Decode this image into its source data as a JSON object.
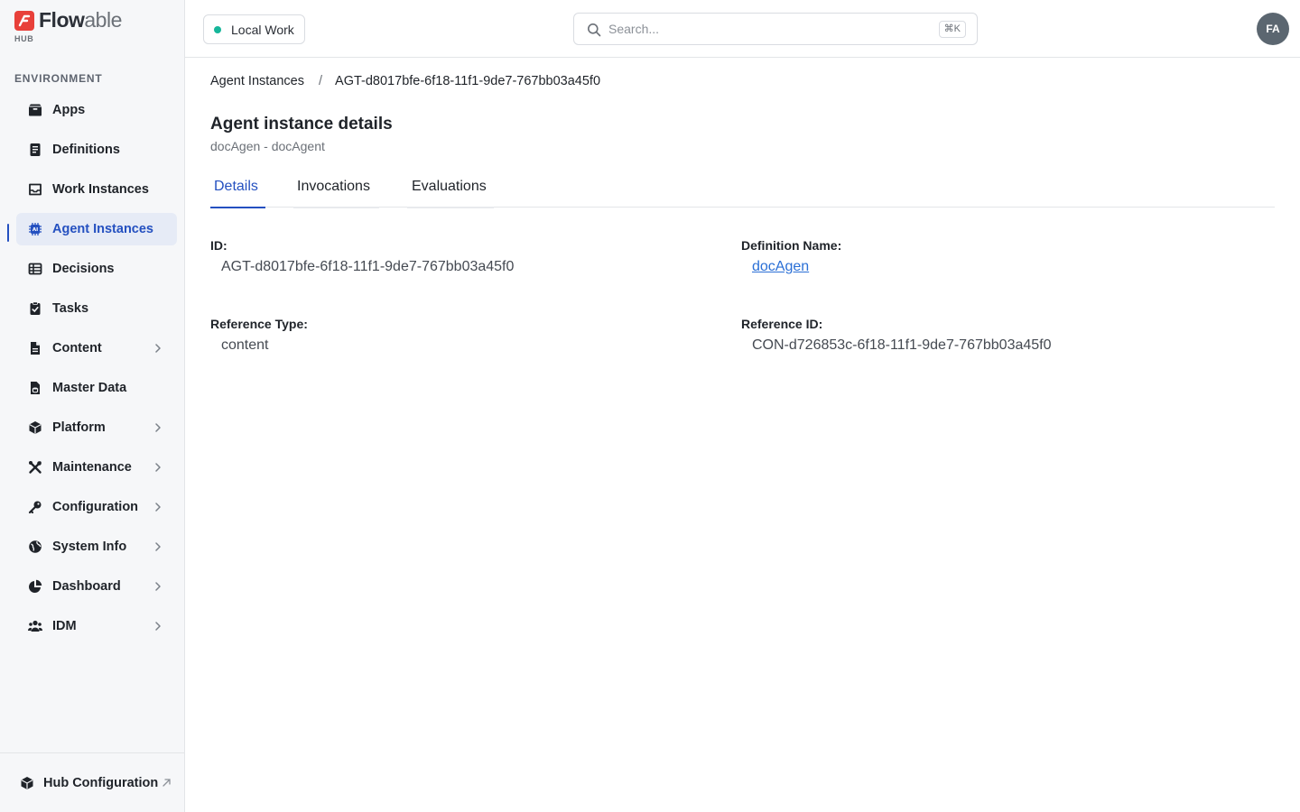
{
  "brand": {
    "name_bold": "Flow",
    "name_light": "able",
    "sub": "HUB"
  },
  "sidebar": {
    "section_label": "ENVIRONMENT",
    "items": [
      {
        "label": "Apps",
        "icon": "box-icon"
      },
      {
        "label": "Definitions",
        "icon": "document-list-icon"
      },
      {
        "label": "Work Instances",
        "icon": "inbox-icon"
      },
      {
        "label": "Agent Instances",
        "icon": "ai-chip-icon",
        "active": true
      },
      {
        "label": "Decisions",
        "icon": "table-icon"
      },
      {
        "label": "Tasks",
        "icon": "clipboard-check-icon"
      },
      {
        "label": "Content",
        "icon": "file-icon",
        "expandable": true
      },
      {
        "label": "Master Data",
        "icon": "file-database-icon"
      },
      {
        "label": "Platform",
        "icon": "cube-icon",
        "expandable": true
      },
      {
        "label": "Maintenance",
        "icon": "tools-icon",
        "expandable": true
      },
      {
        "label": "Configuration",
        "icon": "key-icon",
        "expandable": true
      },
      {
        "label": "System Info",
        "icon": "globe-icon",
        "expandable": true
      },
      {
        "label": "Dashboard",
        "icon": "pie-chart-icon",
        "expandable": true
      },
      {
        "label": "IDM",
        "icon": "users-icon",
        "expandable": true
      }
    ],
    "footer": {
      "label": "Hub Configuration",
      "icon": "cube-icon"
    }
  },
  "header": {
    "environment": "Local Work",
    "search_placeholder": "Search...",
    "search_shortcut": "⌘K",
    "avatar_initials": "FA"
  },
  "main": {
    "breadcrumb": {
      "parent": "Agent Instances",
      "separator": "/",
      "current": "AGT-d8017bfe-6f18-11f1-9de7-767bb03a45f0"
    },
    "title": "Agent instance details",
    "subtitle": "docAgen - docAgent",
    "tabs": [
      {
        "label": "Details",
        "active": true
      },
      {
        "label": "Invocations"
      },
      {
        "label": "Evaluations"
      }
    ],
    "fields": {
      "id": {
        "label": "ID:",
        "value": "AGT-d8017bfe-6f18-11f1-9de7-767bb03a45f0"
      },
      "definition_name": {
        "label": "Definition Name:",
        "value": "docAgen"
      },
      "reference_type": {
        "label": "Reference Type:",
        "value": "content"
      },
      "reference_id": {
        "label": "Reference ID:",
        "value": "CON-d726853c-6f18-11f1-9de7-767bb03a45f0"
      }
    }
  },
  "colors": {
    "accent": "#2450c0",
    "link": "#2a6fd6",
    "status_dot": "#16b69a",
    "brand_red": "#e8403a"
  }
}
